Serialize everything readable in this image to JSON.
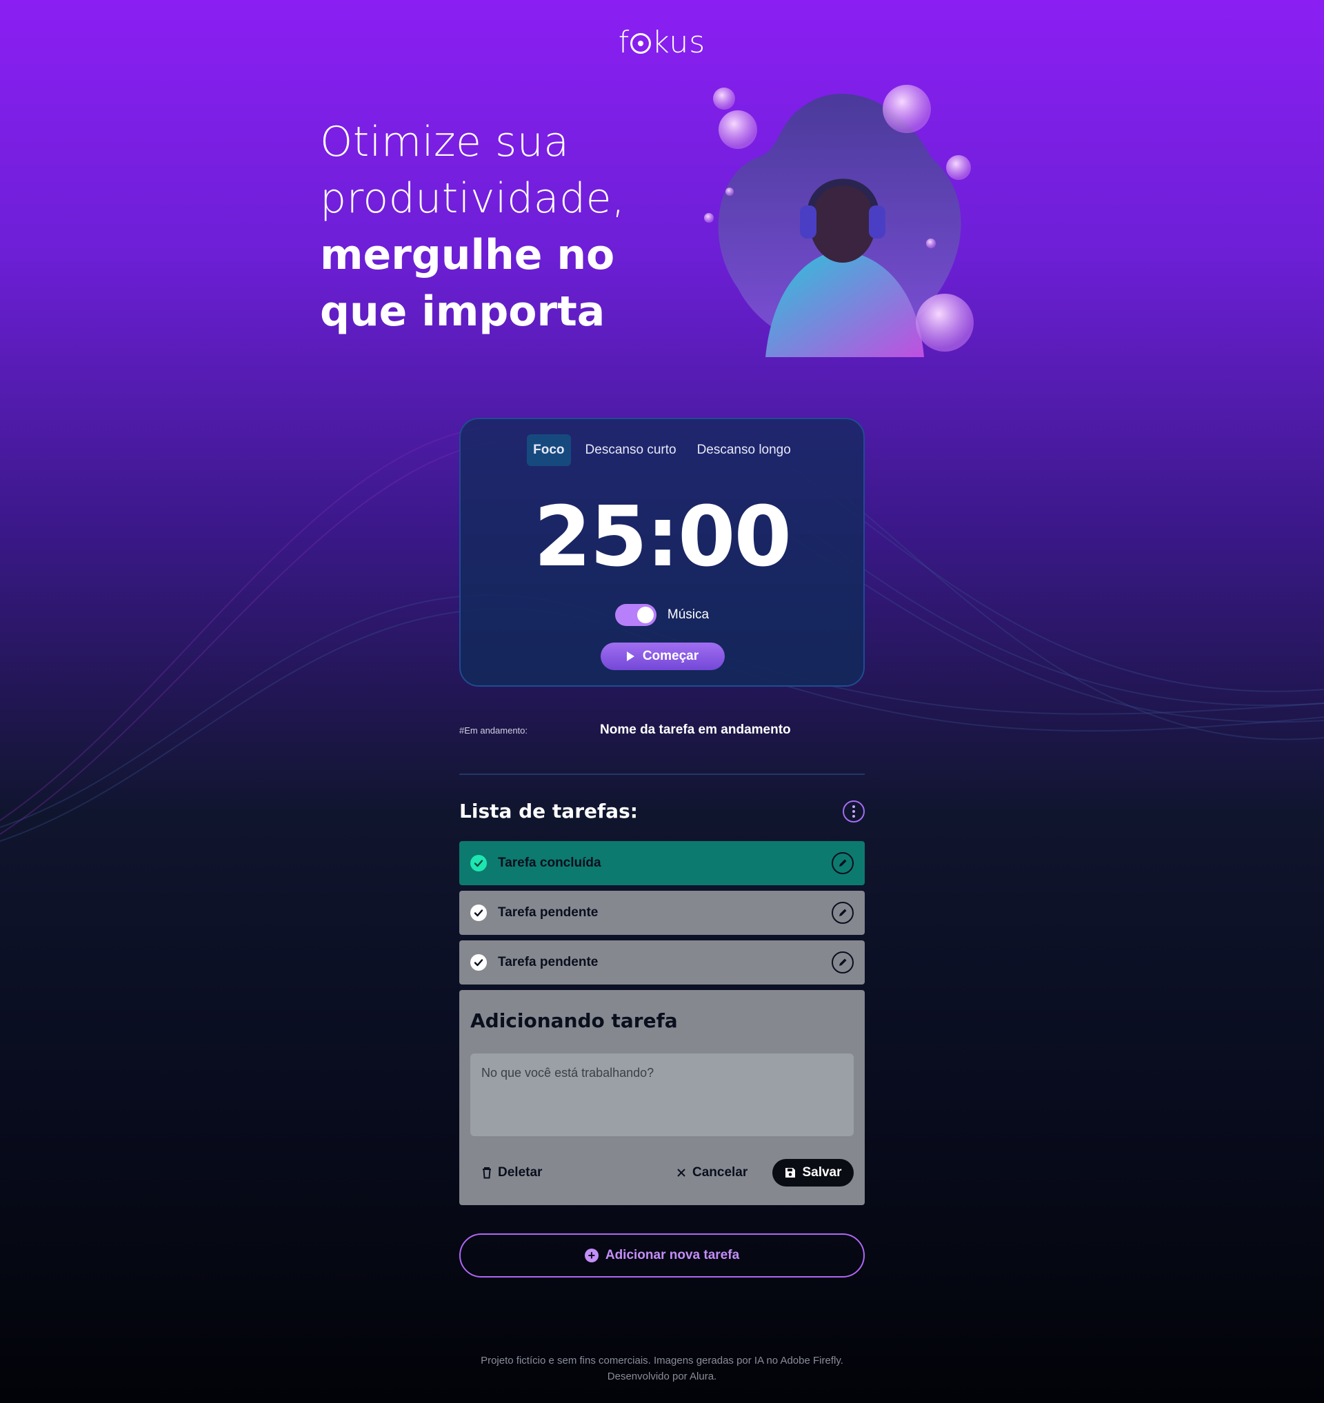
{
  "header": {
    "logo_text_pre": "f",
    "logo_text_post": "kus"
  },
  "hero": {
    "line1": "Otimize sua",
    "line2": "produtividade,",
    "line3": "mergulhe no",
    "line4": "que importa"
  },
  "timer": {
    "tabs": [
      {
        "label": "Foco",
        "active": true
      },
      {
        "label": "Descanso curto",
        "active": false
      },
      {
        "label": "Descanso longo",
        "active": false
      }
    ],
    "time": "25:00",
    "music_label": "Música",
    "music_on": true,
    "start_label": "Começar"
  },
  "in_progress": {
    "tag": "#Em andamento:",
    "name": "Nome da tarefa em andamento"
  },
  "tasks": {
    "title": "Lista de tarefas:",
    "items": [
      {
        "label": "Tarefa concluída",
        "status": "done"
      },
      {
        "label": "Tarefa pendente",
        "status": "pending"
      },
      {
        "label": "Tarefa pendente",
        "status": "pending"
      }
    ]
  },
  "form": {
    "title": "Adicionando tarefa",
    "placeholder": "No que você está trabalhando?",
    "delete_label": "Deletar",
    "cancel_label": "Cancelar",
    "save_label": "Salvar"
  },
  "add_task_label": "Adicionar nova tarefa",
  "footer": {
    "line1": "Projeto fictício e sem fins comerciais. Imagens geradas por IA no Adobe Firefly.",
    "line2": "Desenvolvido por Alura."
  },
  "colors": {
    "accent": "#b87ffa",
    "done_task": "#0d7a6f",
    "pending_task": "#85888f",
    "check_done": "#1ee6b0"
  }
}
